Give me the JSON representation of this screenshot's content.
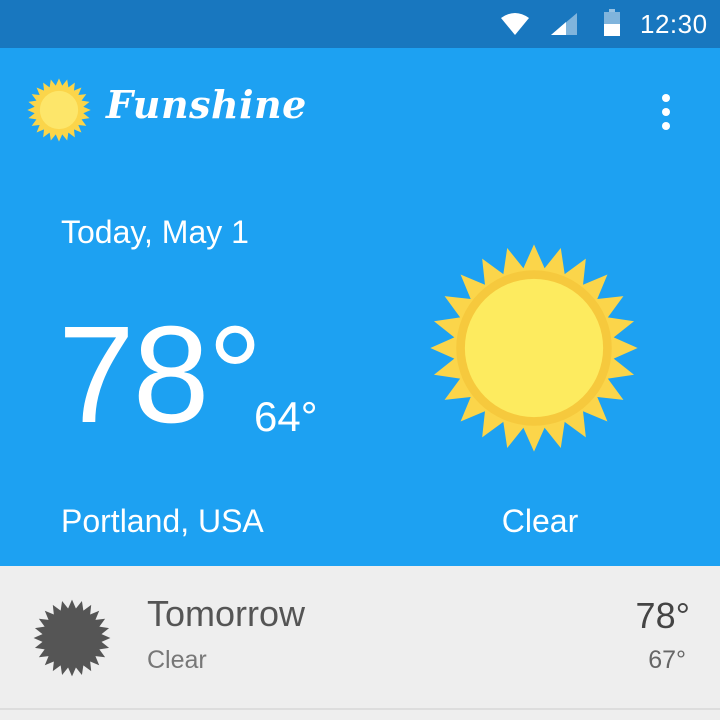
{
  "status_bar": {
    "time": "12:30",
    "icons": [
      "wifi-icon",
      "cell-signal-icon",
      "battery-icon"
    ]
  },
  "app_bar": {
    "title": "Funshine",
    "logo_icon": "sun-logo-icon",
    "menu_icon": "overflow-menu-icon"
  },
  "today": {
    "date": "Today, May 1",
    "high": "78°",
    "low": "64°",
    "location": "Portland, USA",
    "condition": "Clear",
    "icon": "clear-sun-icon"
  },
  "forecast": [
    {
      "day": "Tomorrow",
      "condition": "Clear",
      "high": "78°",
      "low": "67°",
      "icon": "clear-sun-icon"
    }
  ],
  "colors": {
    "status_bar": "#1877bf",
    "primary": "#1da1f2",
    "sun_outer": "#fbd54a",
    "sun_inner": "#fff05a",
    "list_background": "#eeeeee",
    "forecast_icon": "#555555"
  }
}
